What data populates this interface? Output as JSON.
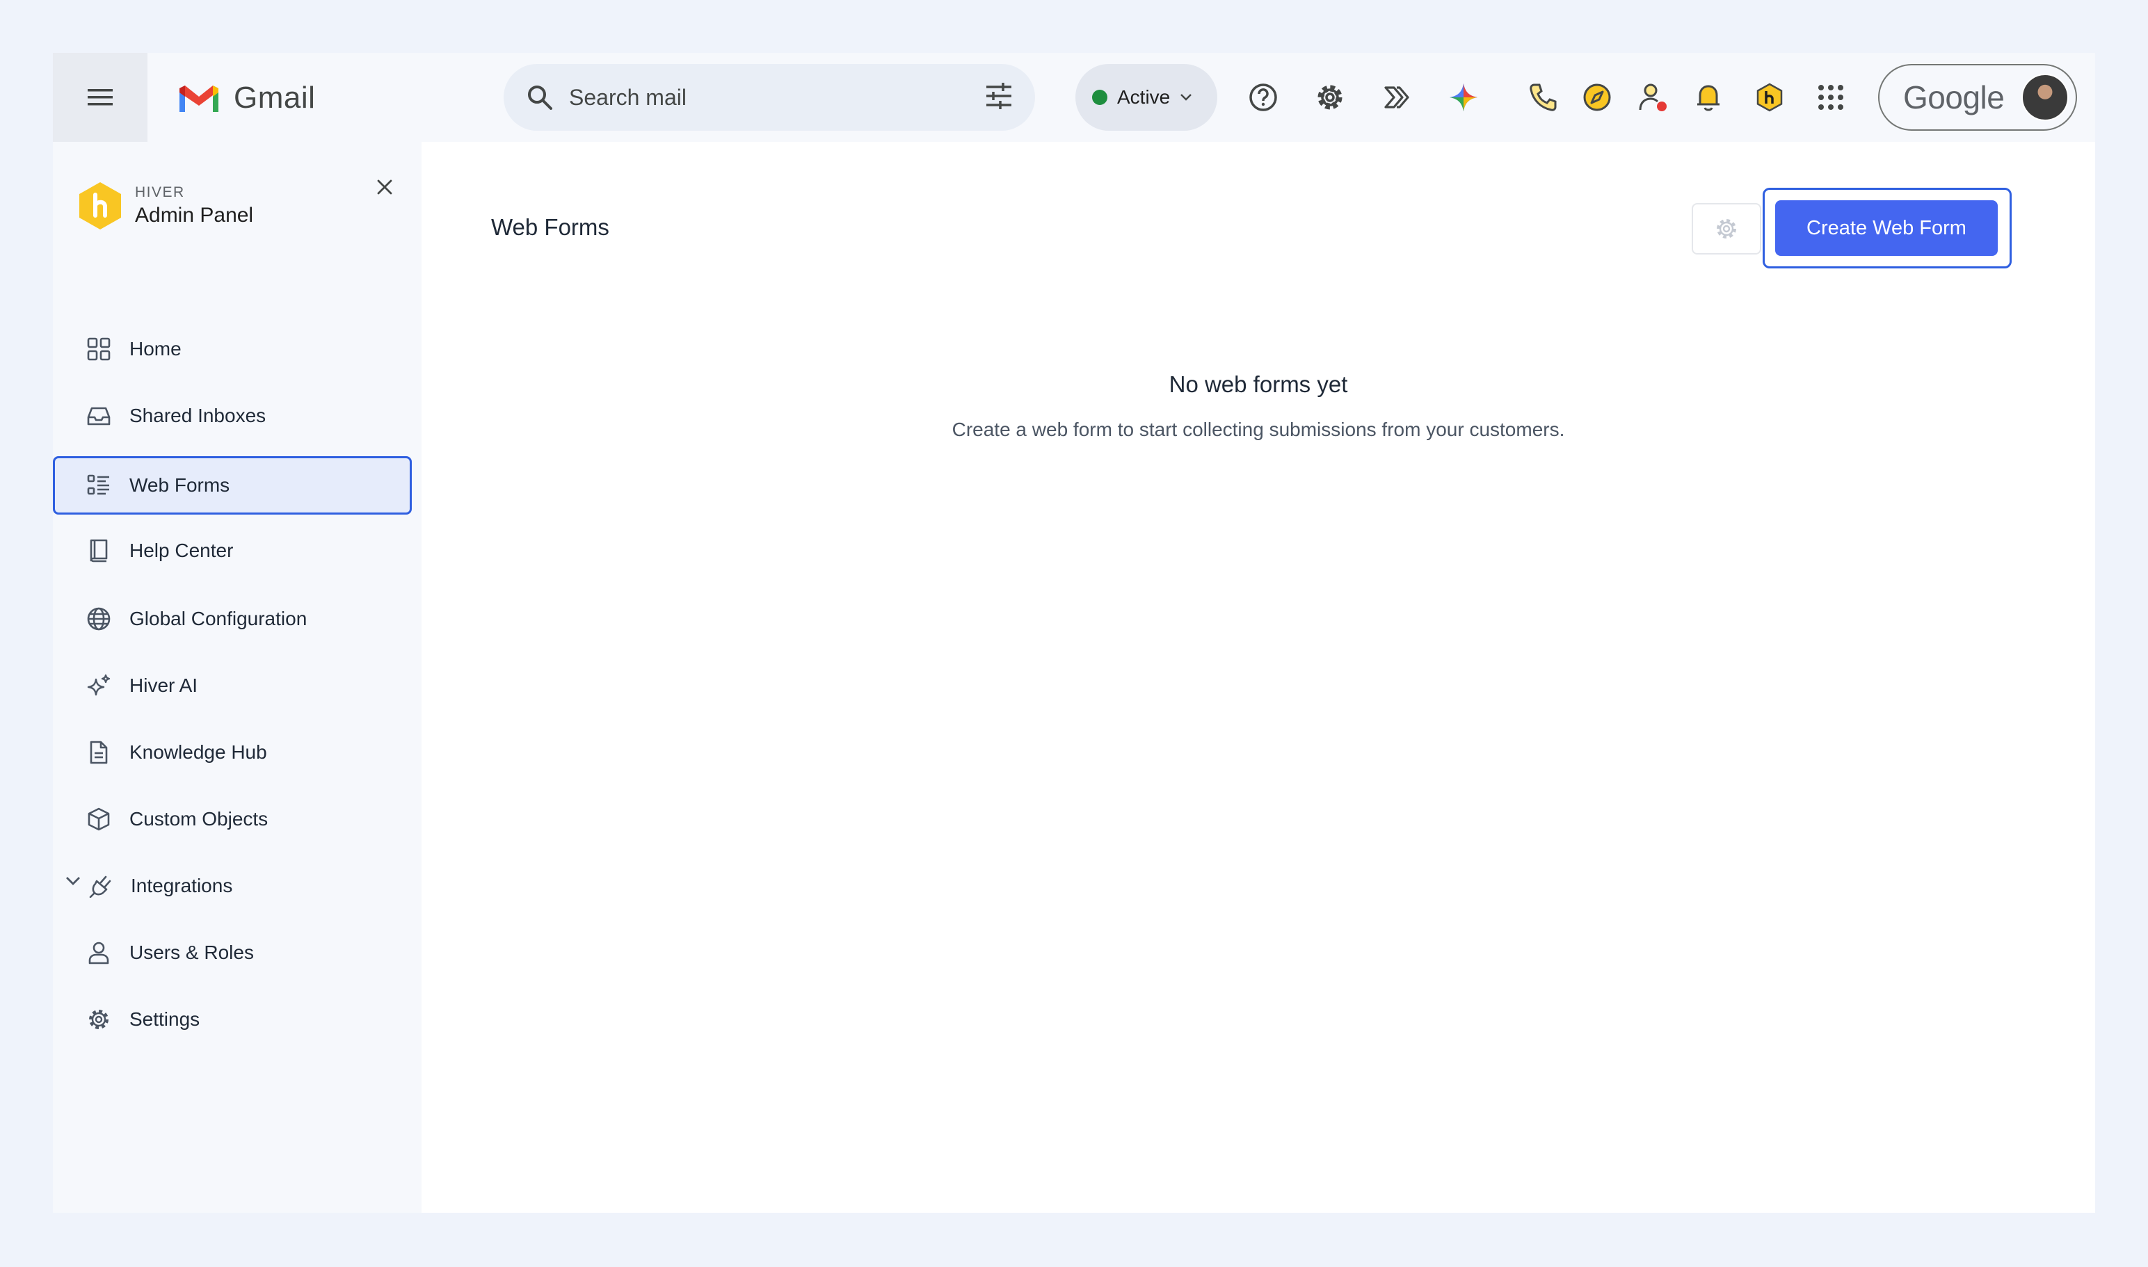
{
  "topbar": {
    "app_name": "Gmail",
    "search_placeholder": "Search mail",
    "status_label": "Active",
    "account_word": "Google"
  },
  "sidebar": {
    "brand_small": "HIVER",
    "brand_title": "Admin Panel",
    "items": [
      {
        "label": "Home"
      },
      {
        "label": "Shared Inboxes"
      },
      {
        "label": "Web Forms"
      },
      {
        "label": "Help Center"
      },
      {
        "label": "Global Configuration"
      },
      {
        "label": "Hiver AI"
      },
      {
        "label": "Knowledge Hub"
      },
      {
        "label": "Custom Objects"
      },
      {
        "label": "Integrations"
      },
      {
        "label": "Users & Roles"
      },
      {
        "label": "Settings"
      }
    ]
  },
  "main": {
    "title": "Web Forms",
    "create_label": "Create Web Form",
    "empty_title": "No web forms yet",
    "empty_desc": "Create a web form to start collecting submissions from your customers."
  },
  "colors": {
    "accent": "#4466f0",
    "focus_ring": "#2f5fe0",
    "active_bg": "#e6ecfb",
    "status_dot": "#1e8e3e",
    "hiver_yellow": "#f9c623"
  }
}
